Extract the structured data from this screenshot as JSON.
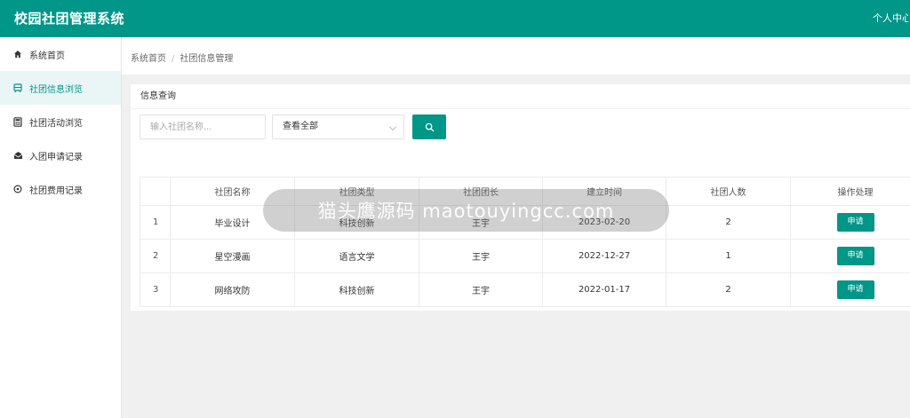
{
  "header": {
    "app_title": "校园社团管理系统",
    "user_center": "个人中心"
  },
  "sidebar": {
    "items": [
      {
        "label": "系统首页",
        "icon": "home-icon",
        "active": false
      },
      {
        "label": "社团信息浏览",
        "icon": "list-icon",
        "active": true
      },
      {
        "label": "社团活动浏览",
        "icon": "calculator-icon",
        "active": false
      },
      {
        "label": "入团申请记录",
        "icon": "envelope-open-icon",
        "active": false
      },
      {
        "label": "社团费用记录",
        "icon": "circle-info-icon",
        "active": false
      }
    ]
  },
  "breadcrumb": {
    "home": "系统首页",
    "separator": "/",
    "current": "社团信息管理"
  },
  "search": {
    "title": "信息查询",
    "placeholder": "输入社团名称...",
    "select_value": "查看全部"
  },
  "table": {
    "headers": [
      "",
      "社团名称",
      "社团类型",
      "社团团长",
      "建立时间",
      "社团人数",
      "操作处理"
    ],
    "action_label": "申请",
    "rows": [
      {
        "idx": "1",
        "name": "毕业设计",
        "type": "科技创新",
        "leader": "王宇",
        "date": "2023-02-20",
        "count": "2"
      },
      {
        "idx": "2",
        "name": "星空漫画",
        "type": "语言文学",
        "leader": "王宇",
        "date": "2022-12-27",
        "count": "1"
      },
      {
        "idx": "3",
        "name": "网络攻防",
        "type": "科技创新",
        "leader": "王宇",
        "date": "2022-01-17",
        "count": "2"
      }
    ]
  },
  "watermark": {
    "text": "猫头鹰源码 maotouyingcc.com"
  },
  "colors": {
    "primary": "#009688",
    "active_bg": "#eaf5f5"
  }
}
